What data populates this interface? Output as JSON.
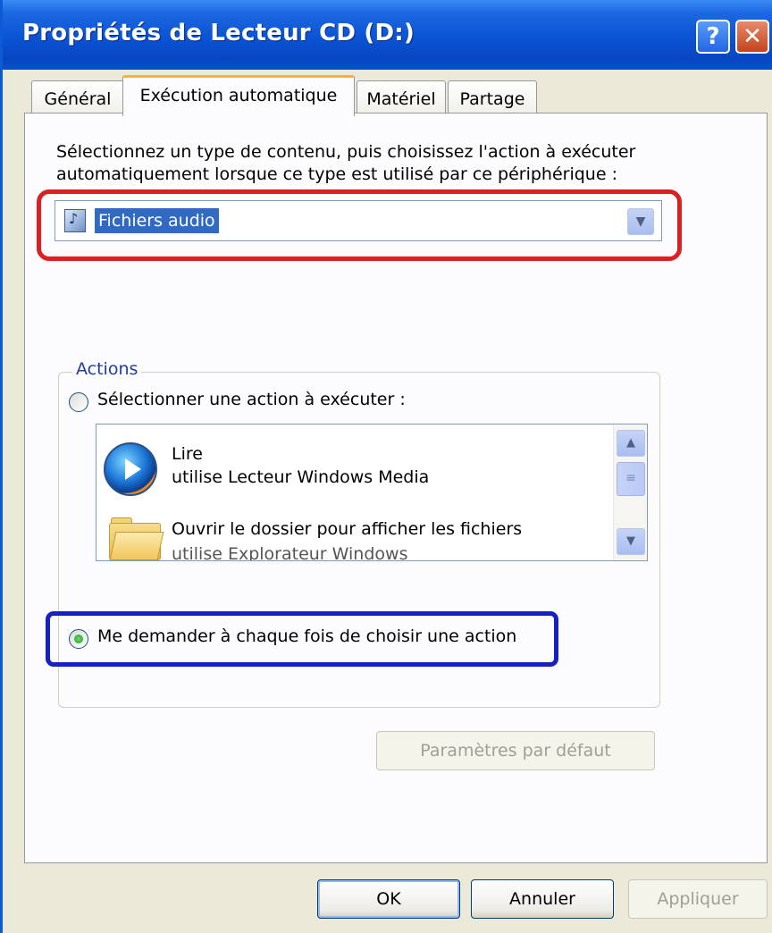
{
  "window": {
    "title": "Propriétés de Lecteur CD (D:)",
    "help_label": "?",
    "close_label": "✕"
  },
  "tabs": [
    {
      "label": "Général",
      "active": false
    },
    {
      "label": "Exécution automatique",
      "active": true
    },
    {
      "label": "Matériel",
      "active": false
    },
    {
      "label": "Partage",
      "active": false
    }
  ],
  "autoplay": {
    "description_line1": "Sélectionnez un type de contenu, puis choisissez l'action à exécuter",
    "description_line2": "automatiquement lorsque ce type est utilisé par ce périphérique :",
    "content_type_selected": "Fichiers audio"
  },
  "actions": {
    "group_label": "Actions",
    "select_action_label": "Sélectionner une action à exécuter :",
    "select_action_checked": false,
    "items": [
      {
        "title": "Lire",
        "subtitle": "utilise Lecteur Windows Media",
        "icon": "windows-media-player-icon"
      },
      {
        "title": "Ouvrir le dossier pour afficher les fichiers",
        "subtitle": "utilise Explorateur Windows",
        "icon": "folder-icon"
      }
    ],
    "ask_each_time_label": "Me demander à chaque fois de choisir une action",
    "ask_each_time_checked": true
  },
  "restore_defaults_label": "Paramètres par défaut",
  "footer": {
    "ok_label": "OK",
    "cancel_label": "Annuler",
    "apply_label": "Appliquer"
  },
  "highlights": {
    "red": "#dc1f1f",
    "blue": "#1621c4"
  },
  "colors": {
    "titlebar": "#0a53d4",
    "dialog_bg": "#ece9d8",
    "selection": "#316ac5"
  }
}
